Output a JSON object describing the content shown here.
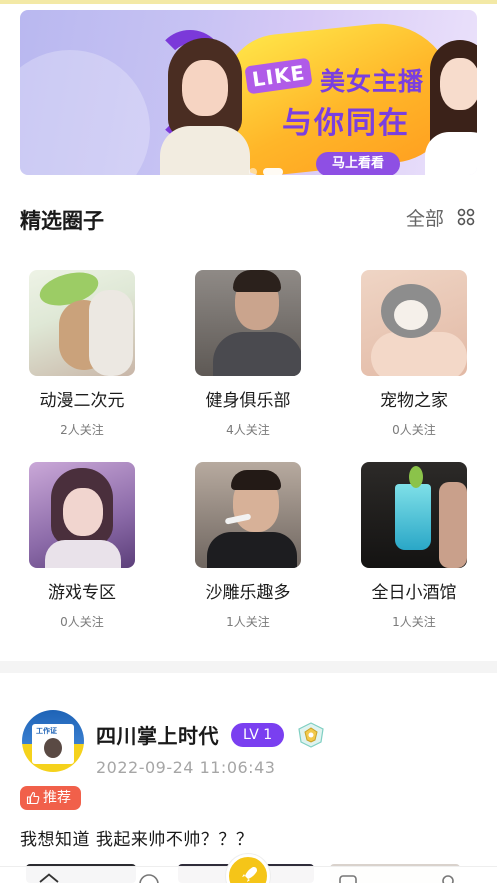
{
  "banner": {
    "brand": "LIKE",
    "headline_1": "美女主播",
    "headline_2": "与你同在",
    "cta_label": "马上看看"
  },
  "section": {
    "title": "精选圈子",
    "all_label": "全部",
    "icon": "grid-icon"
  },
  "circles": [
    {
      "name": "动漫二次元",
      "follow": "2人关注"
    },
    {
      "name": "健身俱乐部",
      "follow": "4人关注"
    },
    {
      "name": "宠物之家",
      "follow": "0人关注"
    },
    {
      "name": "游戏专区",
      "follow": "0人关注"
    },
    {
      "name": "沙雕乐趣多",
      "follow": "1人关注"
    },
    {
      "name": "全日小酒馆",
      "follow": "1人关注"
    }
  ],
  "post": {
    "author": "四川掌上时代",
    "level": "LV 1",
    "time": "2022-09-24 11:06:43",
    "tag": "推荐",
    "text": "我想知道 我起来帅不帅？？？",
    "avatar_caption": "工作证"
  },
  "colors": {
    "accent_purple": "#7a3ff0",
    "tag_red": "#f1604a",
    "fab_yellow": "#f5c518"
  },
  "tabbar": {
    "icons": [
      "home-icon",
      "compass-icon",
      "rocket-icon",
      "message-icon",
      "profile-icon"
    ]
  }
}
